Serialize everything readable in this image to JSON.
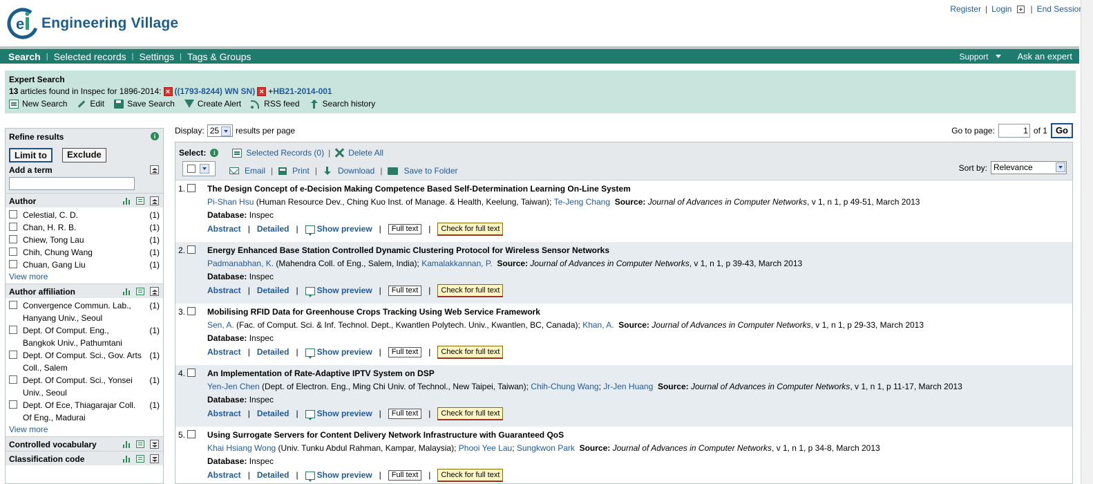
{
  "header": {
    "logo_text": "Engineering Village",
    "links": [
      "Register",
      "Login",
      "End Session"
    ]
  },
  "nav": {
    "items": [
      "Search",
      "Selected records",
      "Settings",
      "Tags & Groups"
    ],
    "support": "Support",
    "ask_expert": "Ask an expert"
  },
  "summary": {
    "title": "Expert Search",
    "count": "13",
    "found_text": "articles found in Inspec for 1896-2014:",
    "query1": "((1793-8244) WN SN)",
    "query2_prefix": "+",
    "query2": "HB21-2014-001",
    "tools": [
      "New Search",
      "Edit",
      "Save Search",
      "Create Alert",
      "RSS feed",
      "Search history"
    ]
  },
  "sidebar": {
    "refine_title": "Refine results",
    "limit_to": "Limit to",
    "exclude": "Exclude",
    "add_term": "Add a term",
    "add_term_value": "",
    "author_title": "Author",
    "authors": [
      {
        "name": "Celestial, C. D.",
        "count": "(1)"
      },
      {
        "name": "Chan, H. R. B.",
        "count": "(1)"
      },
      {
        "name": "Chiew, Tong Lau",
        "count": "(1)"
      },
      {
        "name": "Chih, Chung Wang",
        "count": "(1)"
      },
      {
        "name": "Chuan, Gang Liu",
        "count": "(1)"
      }
    ],
    "view_more": "View more",
    "affil_title": "Author affiliation",
    "affiliations": [
      {
        "name": "Convergence Commun. Lab., Hanyang Univ., Seoul",
        "count": "(1)"
      },
      {
        "name": "Dept. Of Comput. Eng., Bangkok Univ., Pathumtani",
        "count": "(1)"
      },
      {
        "name": "Dept. Of Comput. Sci., Gov. Arts Coll., Salem",
        "count": "(1)"
      },
      {
        "name": "Dept. Of Comput. Sci., Yonsei Univ., Seoul",
        "count": "(1)"
      },
      {
        "name": "Dept. Of Ece, Thiagarajar Coll. Of Eng., Madurai",
        "count": "(1)"
      }
    ],
    "controlled_vocab": "Controlled vocabulary",
    "classification": "Classification code"
  },
  "display": {
    "label": "Display:",
    "per_page": "25",
    "suffix": "results per page",
    "goto_label": "Go to page:",
    "page": "1",
    "of": "of 1",
    "go": "Go"
  },
  "toolbar": {
    "select_label": "Select:",
    "selected_records": "Selected Records (0)",
    "delete_all": "Delete All",
    "email": "Email",
    "print": "Print",
    "download": "Download",
    "save_folder": "Save to Folder",
    "sort_label": "Sort by:",
    "sort_value": "Relevance"
  },
  "record_actions": {
    "abstract": "Abstract",
    "detailed": "Detailed",
    "preview": "Show preview",
    "fulltext": "Full text",
    "check": "Check for full text",
    "database_label": "Database:",
    "source_label": "Source:"
  },
  "records": [
    {
      "num": "1.",
      "title": "The Design Concept of e-Decision Making Competence Based Self-Determination Learning On-Line System",
      "author1": "Pi-Shan Hsu",
      "affil": "(Human Resource Dev., Ching Kuo Inst. of Manage. & Health, Keelung, Taiwan);",
      "author2": "Te-Jeng Chang",
      "author3": "",
      "journal": "Journal of Advances in Computer Networks",
      "details": ", v 1, n 1, p 49-51, March 2013",
      "database": "Inspec"
    },
    {
      "num": "2.",
      "title": "Energy Enhanced Base Station Controlled Dynamic Clustering Protocol for Wireless Sensor Networks",
      "author1": "Padmanabhan, K.",
      "affil": "(Mahendra Coll. of Eng., Salem, India);",
      "author2": "Kamalakkannan, P.",
      "author3": "",
      "journal": "Journal of Advances in Computer Networks",
      "details": ", v 1, n 1, p 39-43, March 2013",
      "database": "Inspec"
    },
    {
      "num": "3.",
      "title": "Mobilising RFID Data for Greenhouse Crops Tracking Using Web Service Framework",
      "author1": "Sen, A.",
      "affil": "(Fac. of Comput. Sci. & Inf. Technol. Dept., Kwantlen Polytech. Univ., Kwantlen, BC, Canada);",
      "author2": "Khan, A.",
      "author3": "",
      "journal": "Journal of Advances in Computer Networks",
      "details": ", v 1, n 1, p 29-33, March 2013",
      "database": "Inspec"
    },
    {
      "num": "4.",
      "title": "An Implementation of Rate-Adaptive IPTV System on DSP",
      "author1": "Yen-Jen Chen",
      "affil": "(Dept. of Electron. Eng., Ming Chi Univ. of Technol., New Taipei, Taiwan);",
      "author2": "Chih-Chung Wang",
      "author3": "Jr-Jen Huang",
      "journal": "Journal of Advances in Computer Networks",
      "details": ", v 1, n 1, p 11-17, March 2013",
      "database": "Inspec"
    },
    {
      "num": "5.",
      "title": "Using Surrogate Servers for Content Delivery Network Infrastructure with Guaranteed QoS",
      "author1": "Khai Hsiang Wong",
      "affil": "(Univ. Tunku Abdul Rahman, Kampar, Malaysia);",
      "author2": "Phooi Yee Lau",
      "author3": "Sungkwon Park",
      "journal": "Journal of Advances in Computer Networks",
      "details": ", v 1, n 1, p 34-8, March 2013",
      "database": "Inspec"
    }
  ],
  "colors": {
    "nav": "#1d7c6d",
    "summary_bg": "#c9e4dc",
    "link": "#1f5a99",
    "logo": "#1a5d8f"
  }
}
